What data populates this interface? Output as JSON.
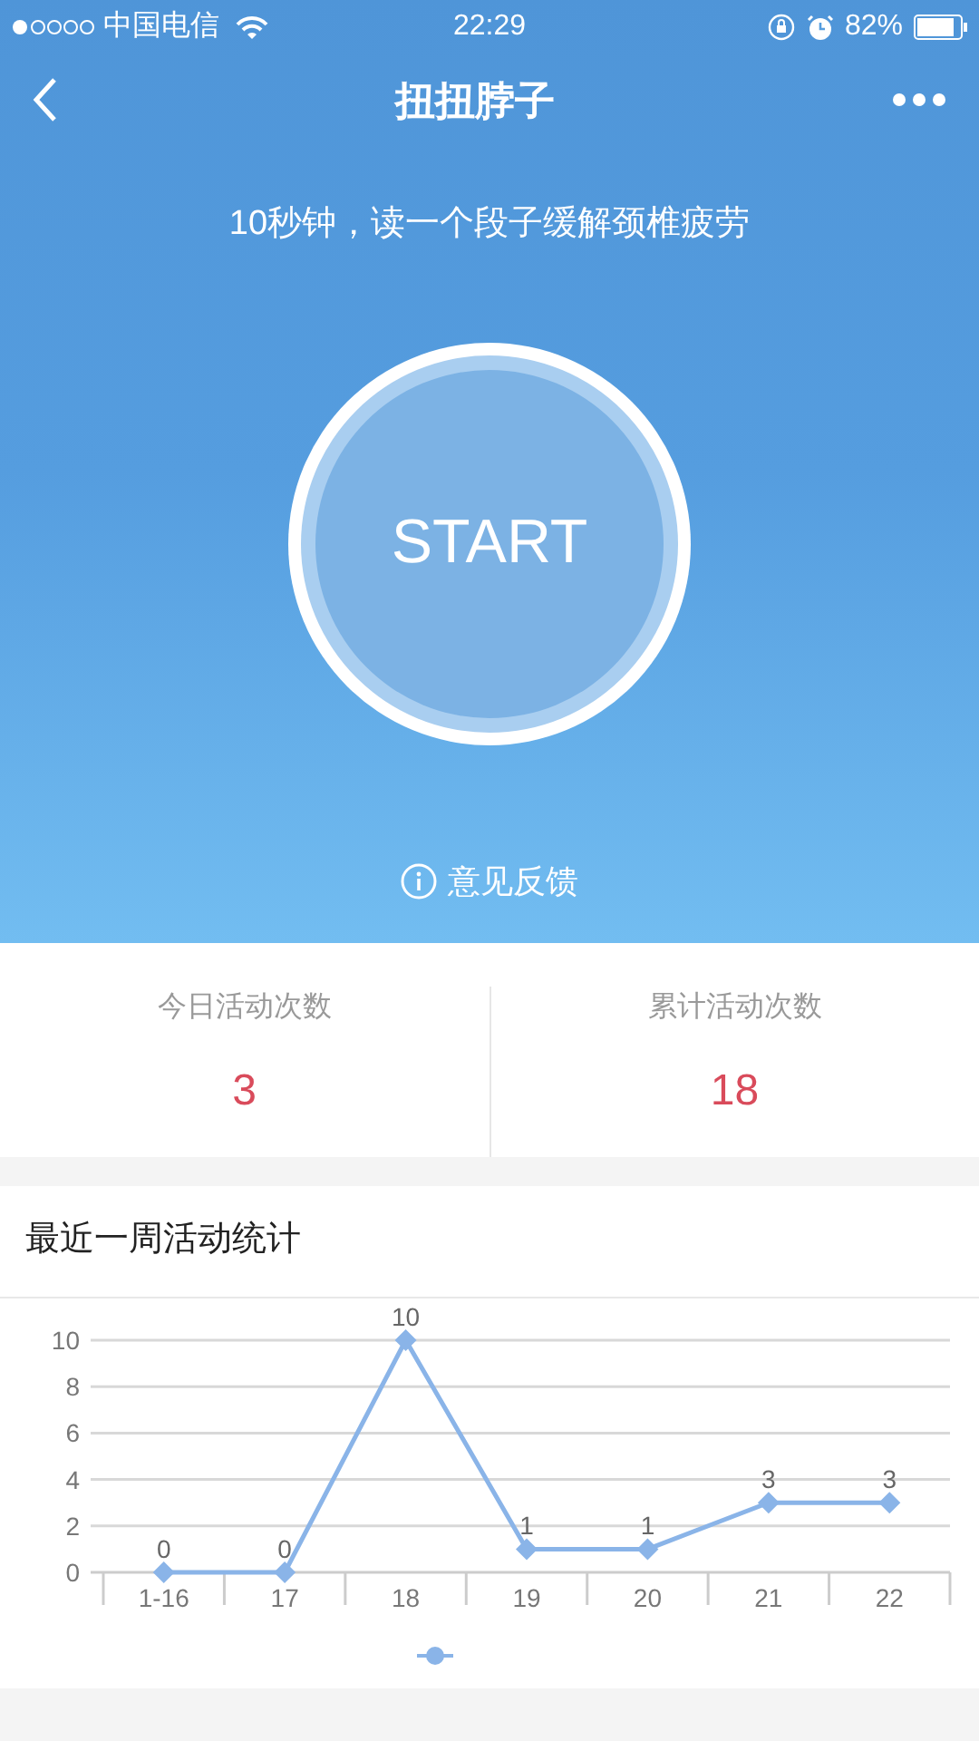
{
  "status_bar": {
    "carrier": "中国电信",
    "time": "22:29",
    "battery": "82%"
  },
  "nav": {
    "title": "扭扭脖子"
  },
  "hero": {
    "subtitle": "10秒钟，读一个段子缓解颈椎疲劳",
    "button": "START",
    "feedback": "意见反馈"
  },
  "stats": [
    {
      "label": "今日活动次数",
      "value": "3"
    },
    {
      "label": "累计活动次数",
      "value": "18"
    }
  ],
  "chart": {
    "title": "最近一周活动统计",
    "chart_data": {
      "type": "line",
      "categories": [
        "1-16",
        "17",
        "18",
        "19",
        "20",
        "21",
        "22"
      ],
      "series": [
        {
          "color": "#8ab4e8",
          "marker": "diamond",
          "values": [
            0,
            0,
            10,
            1,
            1,
            3,
            3
          ]
        }
      ],
      "grid": true,
      "ylim": [
        0,
        10
      ],
      "yticks": [
        0,
        2,
        4,
        6,
        8,
        10
      ],
      "data_labels": true
    }
  }
}
